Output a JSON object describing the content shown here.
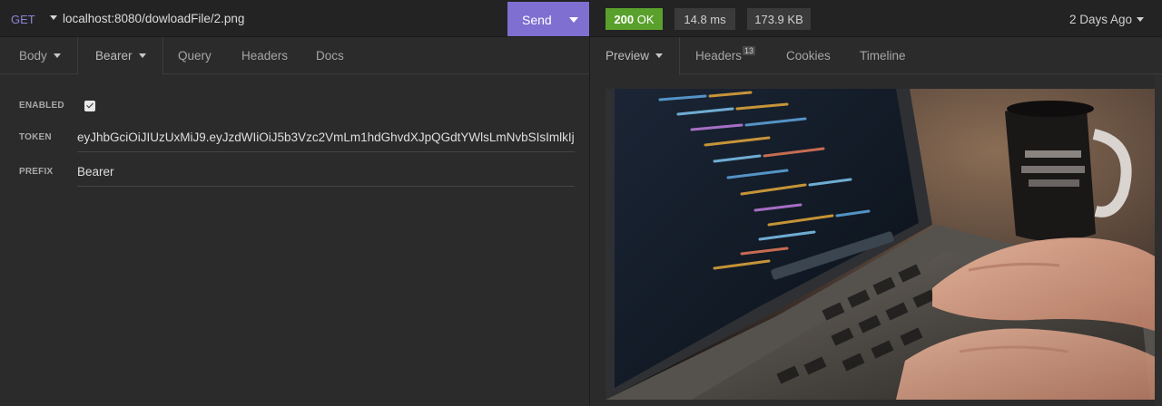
{
  "request": {
    "method": "GET",
    "url": "localhost:8080/dowloadFile/2.png",
    "send_label": "Send",
    "tabs": [
      {
        "label": "Body",
        "has_dropdown": true
      },
      {
        "label": "Bearer",
        "has_dropdown": true,
        "active": true
      },
      {
        "label": "Query"
      },
      {
        "label": "Headers"
      },
      {
        "label": "Docs"
      }
    ],
    "auth": {
      "enabled_label": "ENABLED",
      "enabled": true,
      "token_label": "TOKEN",
      "token_value": "eyJhbGciOiJIUzUxMiJ9.eyJzdWIiOiJ5b3Vzc2VmLm1hdGhvdXJpQGdtYWlsLmNvbSIsImlkIjoiU",
      "prefix_label": "PREFIX",
      "prefix_value": "Bearer"
    }
  },
  "response": {
    "status_code": "200",
    "status_text": "OK",
    "time": "14.8 ms",
    "size": "173.9 KB",
    "age": "2 Days Ago",
    "tabs": [
      {
        "label": "Preview",
        "has_dropdown": true,
        "active": true
      },
      {
        "label": "Headers",
        "badge": "13"
      },
      {
        "label": "Cookies"
      },
      {
        "label": "Timeline"
      }
    ],
    "preview_image_icon": "laptop-photo-image"
  },
  "colors": {
    "accent": "#7e6fd0",
    "status_ok": "#5aa02c",
    "method": "#8f85d8",
    "background": "#2b2b2b"
  }
}
